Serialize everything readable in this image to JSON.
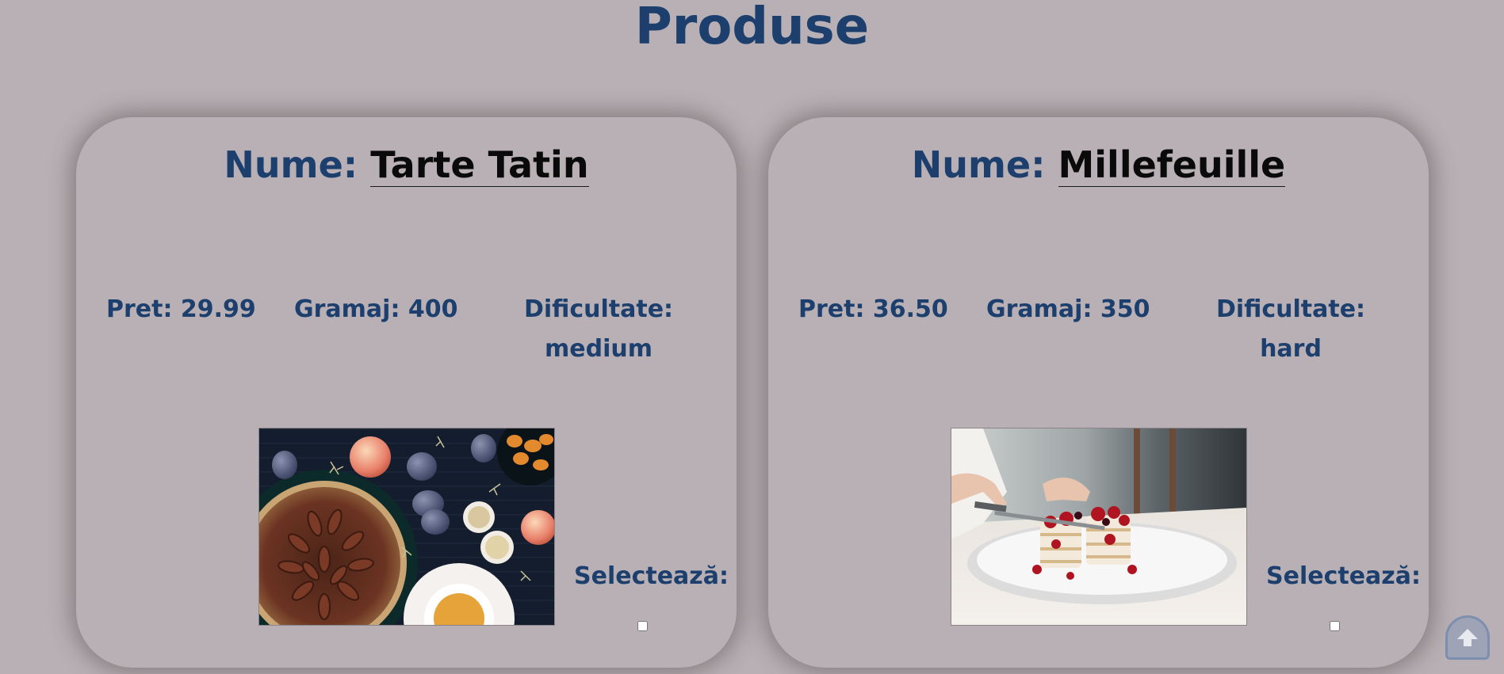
{
  "page": {
    "title": "Produse"
  },
  "products": [
    {
      "name_label": "Nume:",
      "name": "Tarte Tatin",
      "price_text": "Pret: 29.99",
      "weight_text": "Gramaj: 400",
      "difficulty_label": "Dificultate:",
      "difficulty": "medium",
      "select_label": "Selectează:",
      "selected": false
    },
    {
      "name_label": "Nume:",
      "name": "Millefeuille",
      "price_text": "Pret: 36.50",
      "weight_text": "Gramaj: 350",
      "difficulty_label": "Dificultate:",
      "difficulty": "hard",
      "select_label": "Selectează:",
      "selected": false
    }
  ],
  "controls": {
    "back_to_top_icon": "arrow-up-icon"
  },
  "colors": {
    "background": "#b8b0b4",
    "heading": "#1c3f6e",
    "name_value": "#0a0a0a"
  }
}
